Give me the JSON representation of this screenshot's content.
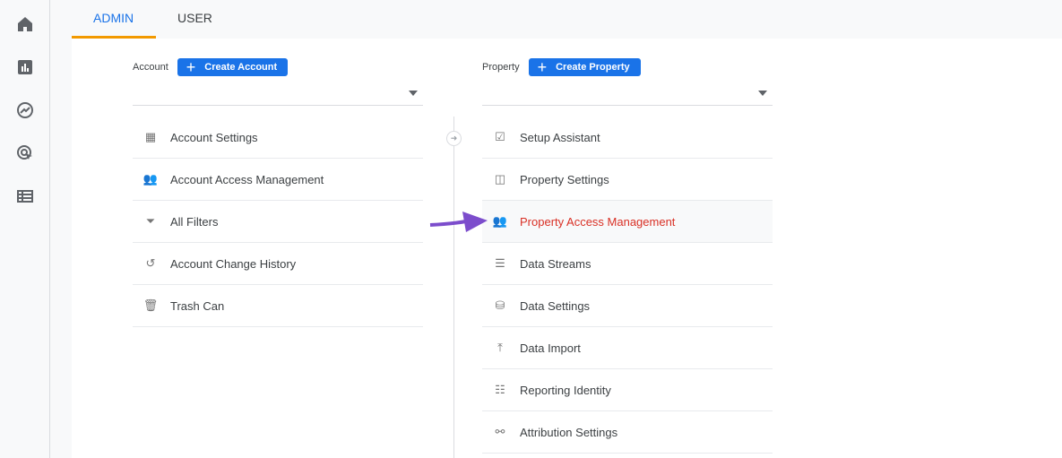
{
  "tabs": [
    {
      "label": "ADMIN",
      "active": true
    },
    {
      "label": "USER",
      "active": false
    }
  ],
  "rail_icons": [
    "home-icon",
    "reports-icon",
    "explore-icon",
    "advertising-icon",
    "configure-icon"
  ],
  "account": {
    "label": "Account",
    "create_label": "Create Account",
    "selected": "",
    "items": [
      {
        "label": "Account Settings",
        "icon": "building-icon"
      },
      {
        "label": "Account Access Management",
        "icon": "people-icon"
      },
      {
        "label": "All Filters",
        "icon": "filter-icon"
      },
      {
        "label": "Account Change History",
        "icon": "history-icon"
      },
      {
        "label": "Trash Can",
        "icon": "trash-icon"
      }
    ]
  },
  "property": {
    "label": "Property",
    "create_label": "Create Property",
    "selected": "",
    "items": [
      {
        "label": "Setup Assistant",
        "icon": "clipboard-check-icon"
      },
      {
        "label": "Property Settings",
        "icon": "layout-icon"
      },
      {
        "label": "Property Access Management",
        "icon": "people-icon",
        "highlighted": true
      },
      {
        "label": "Data Streams",
        "icon": "streams-icon"
      },
      {
        "label": "Data Settings",
        "icon": "database-icon"
      },
      {
        "label": "Data Import",
        "icon": "upload-icon"
      },
      {
        "label": "Reporting Identity",
        "icon": "identity-icon"
      },
      {
        "label": "Attribution Settings",
        "icon": "attribution-icon"
      }
    ]
  },
  "colors": {
    "accent": "#1a73e8",
    "tab_underline": "#f29900",
    "highlight_text": "#d93025",
    "arrow": "#7c4dcc"
  }
}
